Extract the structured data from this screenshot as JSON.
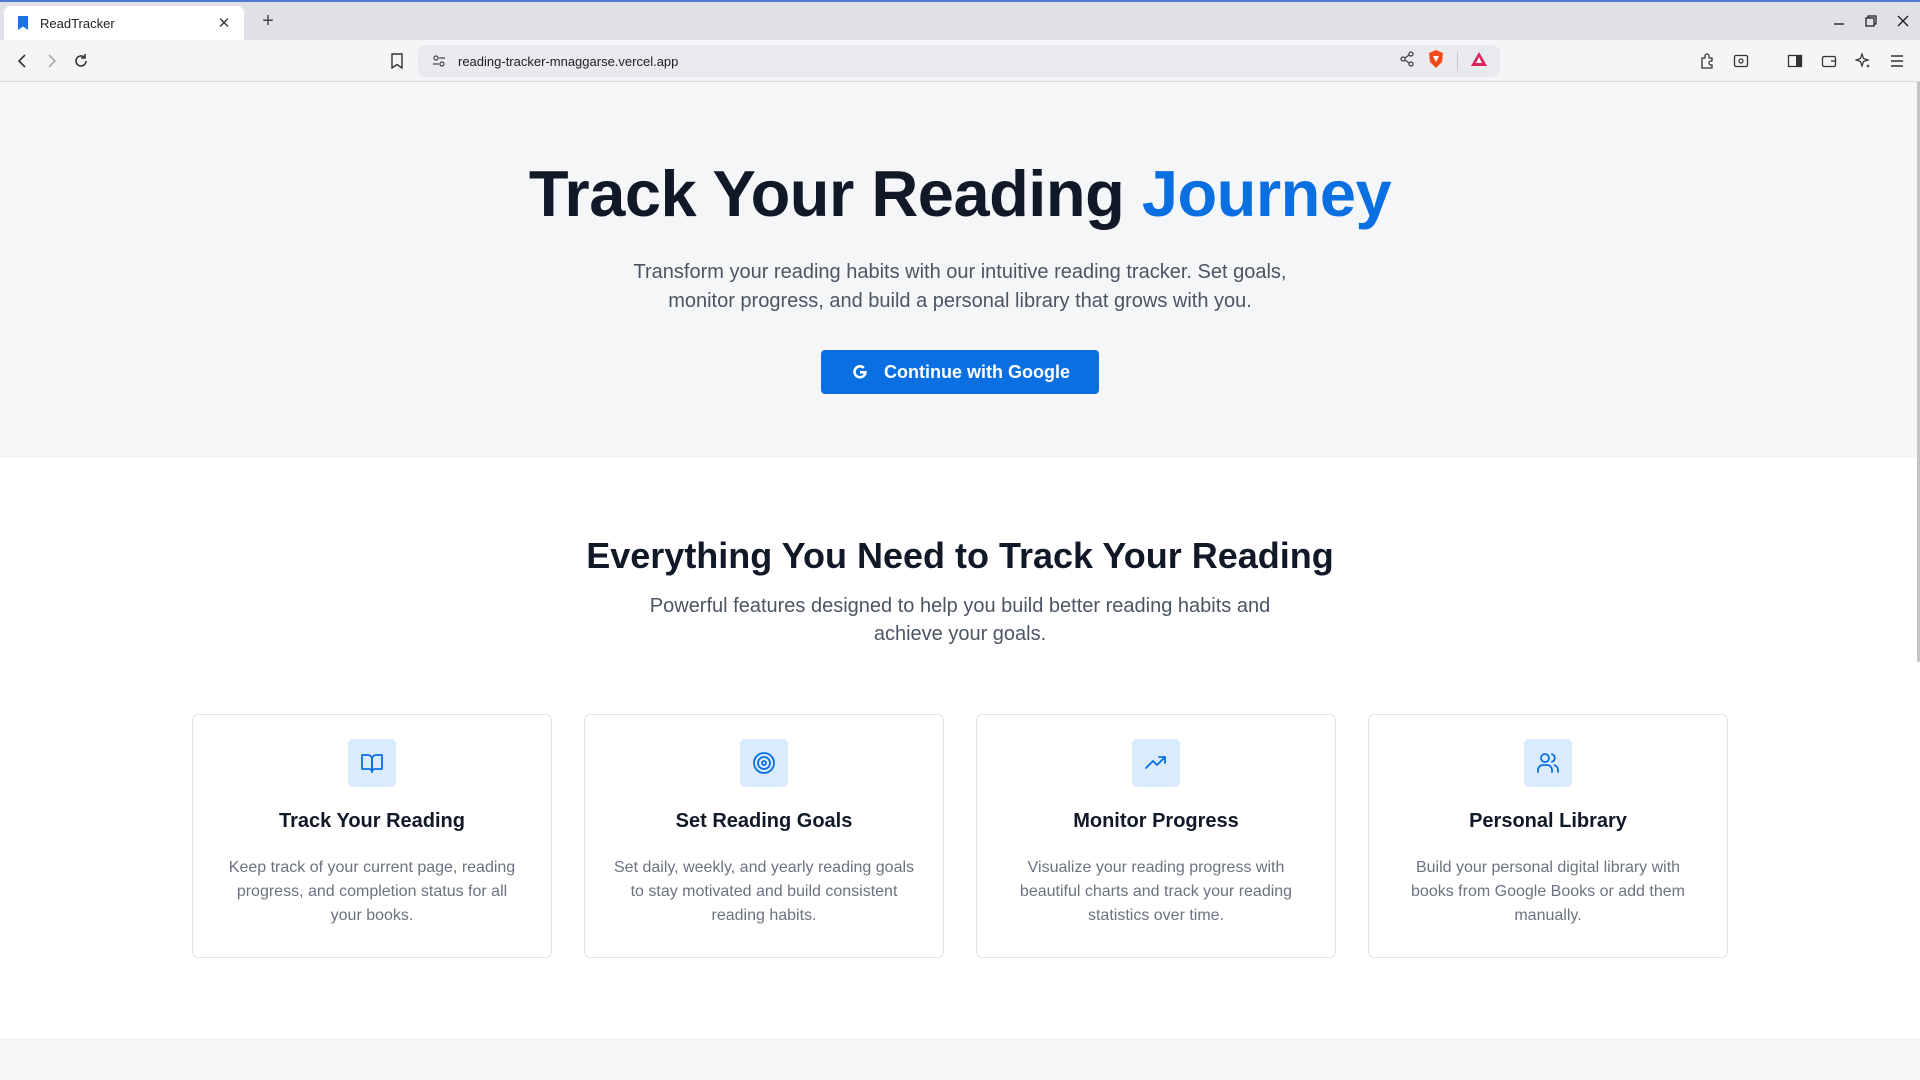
{
  "browser": {
    "tab_title": "ReadTracker",
    "url": "reading-tracker-mnaggarse.vercel.app",
    "icons": [
      "bookmark-favicon",
      "close-icon",
      "plus-icon",
      "back-icon",
      "forward-icon",
      "reload-icon",
      "bookmark-icon",
      "site-info-icon",
      "share-icon",
      "brave-shields-icon",
      "brave-rewards-icon",
      "extensions-icon",
      "leo-icon",
      "sidebar-icon",
      "wallet-icon",
      "ai-sparkle-icon",
      "menu-icon"
    ]
  },
  "hero": {
    "title_main": "Track Your Reading ",
    "title_accent": "Journey",
    "subtitle": "Transform your reading habits with our intuitive reading tracker. Set goals, monitor progress, and build a personal library that grows with you.",
    "cta_label": "Continue with Google"
  },
  "features": {
    "title": "Everything You Need to Track Your Reading",
    "subtitle": "Powerful features designed to help you build better reading habits and achieve your goals.",
    "cards": [
      {
        "icon": "book-open-icon",
        "title": "Track Your Reading",
        "desc": "Keep track of your current page, reading progress, and completion status for all your books."
      },
      {
        "icon": "target-icon",
        "title": "Set Reading Goals",
        "desc": "Set daily, weekly, and yearly reading goals to stay motivated and build consistent reading habits."
      },
      {
        "icon": "trending-up-icon",
        "title": "Monitor Progress",
        "desc": "Visualize your reading progress with beautiful charts and track your reading statistics over time."
      },
      {
        "icon": "users-icon",
        "title": "Personal Library",
        "desc": "Build your personal digital library with books from Google Books or add them manually."
      }
    ]
  },
  "colors": {
    "accent": "#0a6fe0",
    "icon_bg": "#d9ebfc",
    "hero_bg": "#f5f6f8"
  }
}
